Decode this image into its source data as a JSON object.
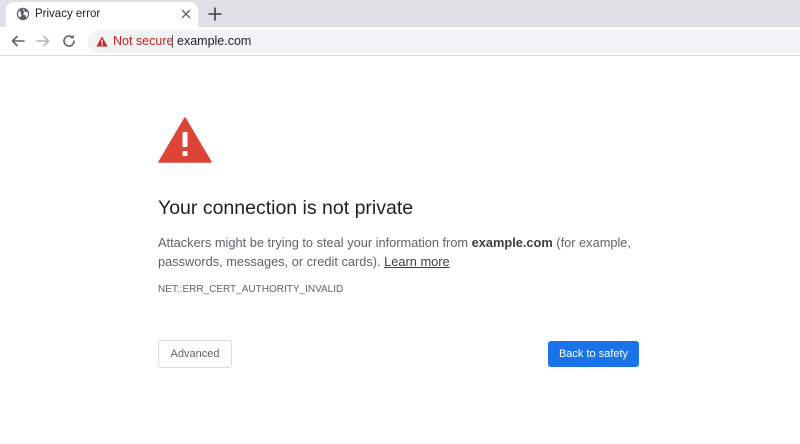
{
  "tab": {
    "title": "Privacy error",
    "favicon": "globe-icon",
    "close_icon": "close-icon",
    "new_tab_icon": "plus-icon"
  },
  "toolbar": {
    "back_icon": "arrow-left-icon",
    "forward_icon": "arrow-right-icon",
    "reload_icon": "reload-icon"
  },
  "omnibox": {
    "security_icon": "warning-triangle-icon",
    "security_label": "Not secure",
    "url": "example.com"
  },
  "interstitial": {
    "icon": "warning-triangle-icon",
    "heading": "Your connection is not private",
    "body_prefix": "Attackers might be trying to steal your information from ",
    "body_domain": "example.com",
    "body_suffix": " (for example, passwords, messages, or credit cards). ",
    "learn_more": "Learn more",
    "error_code": "NET::ERR_CERT_AUTHORITY_INVALID",
    "advanced_label": "Advanced",
    "back_label": "Back to safety"
  },
  "colors": {
    "tabstrip_bg": "#dee1e6",
    "omnibox_bg": "#f1f3f4",
    "warning_red": "#c5221f",
    "big_warning_red": "#db4437",
    "primary_blue": "#1a73e8",
    "heading_text": "#202124",
    "body_text": "#5f6368"
  }
}
